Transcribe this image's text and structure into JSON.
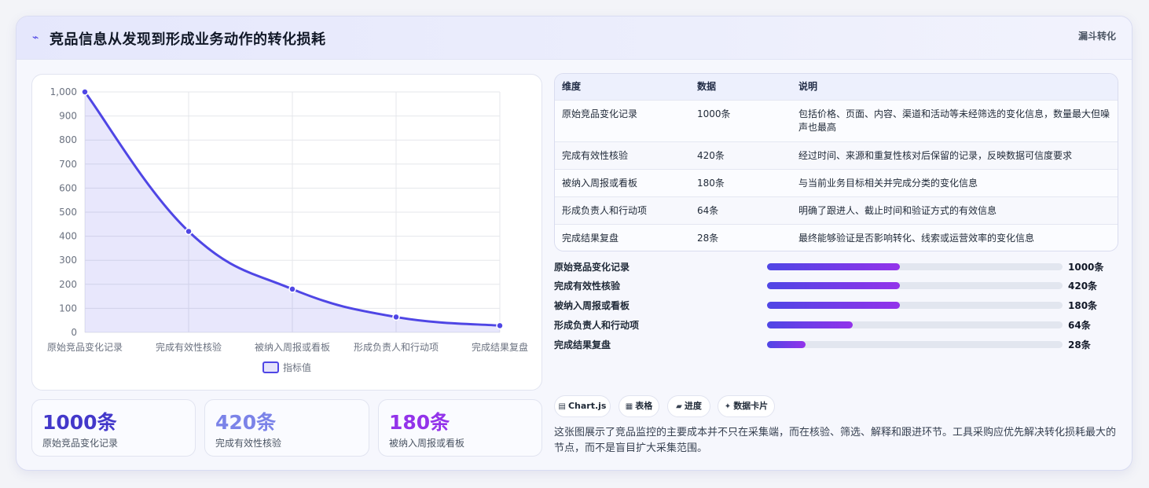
{
  "header": {
    "title": "竞品信息从发现到形成业务动作的转化损耗",
    "badge": "漏斗转化"
  },
  "chart_data": {
    "type": "line",
    "categories": [
      "原始竞品变化记录",
      "完成有效性核验",
      "被纳入周报或看板",
      "形成负责人和行动项",
      "完成结果复盘"
    ],
    "series": [
      {
        "name": "指标值",
        "values": [
          1000,
          420,
          180,
          64,
          28
        ]
      }
    ],
    "ylim": [
      0,
      1000
    ],
    "yticks": [
      "0",
      "100",
      "200",
      "300",
      "400",
      "500",
      "600",
      "700",
      "800",
      "900",
      "1,000"
    ],
    "fill": "area",
    "legend": "bottom",
    "grid": true,
    "color": "#4f46e5"
  },
  "kpis": [
    {
      "value": "1000条",
      "label": "原始竞品变化记录",
      "color": "#4338ca"
    },
    {
      "value": "420条",
      "label": "完成有效性核验",
      "color": "#7b83e8"
    },
    {
      "value": "180条",
      "label": "被纳入周报或看板",
      "color": "#9333ea"
    }
  ],
  "table": {
    "headers": [
      "维度",
      "数据",
      "说明"
    ],
    "rows": [
      {
        "dim": "原始竞品变化记录",
        "data": "1000条",
        "note": "包括价格、页面、内容、渠道和活动等未经筛选的变化信息，数量最大但噪声也最高"
      },
      {
        "dim": "完成有效性核验",
        "data": "420条",
        "note": "经过时间、来源和重复性核对后保留的记录，反映数据可信度要求"
      },
      {
        "dim": "被纳入周报或看板",
        "data": "180条",
        "note": "与当前业务目标相关并完成分类的变化信息"
      },
      {
        "dim": "形成负责人和行动项",
        "data": "64条",
        "note": "明确了跟进人、截止时间和验证方式的有效信息"
      },
      {
        "dim": "完成结果复盘",
        "data": "28条",
        "note": "最终能够验证是否影响转化、线索或运营效率的变化信息"
      }
    ]
  },
  "progress": [
    {
      "label": "原始竞品变化记录",
      "value": "1000条",
      "fraction": 0.45
    },
    {
      "label": "完成有效性核验",
      "value": "420条",
      "fraction": 0.45
    },
    {
      "label": "被纳入周报或看板",
      "value": "180条",
      "fraction": 0.45
    },
    {
      "label": "形成负责人和行动项",
      "value": "64条",
      "fraction": 0.29
    },
    {
      "label": "完成结果复盘",
      "value": "28条",
      "fraction": 0.13
    }
  ],
  "chips": [
    {
      "icon": "▤",
      "label": "Chart.js"
    },
    {
      "icon": "▦",
      "label": "表格"
    },
    {
      "icon": "▰",
      "label": "进度"
    },
    {
      "icon": "✦",
      "label": "数据卡片"
    }
  ],
  "description": "这张图展示了竞品监控的主要成本并不只在采集端，而在核验、筛选、解释和跟进环节。工具采购应优先解决转化损耗最大的节点，而不是盲目扩大采集范围。"
}
